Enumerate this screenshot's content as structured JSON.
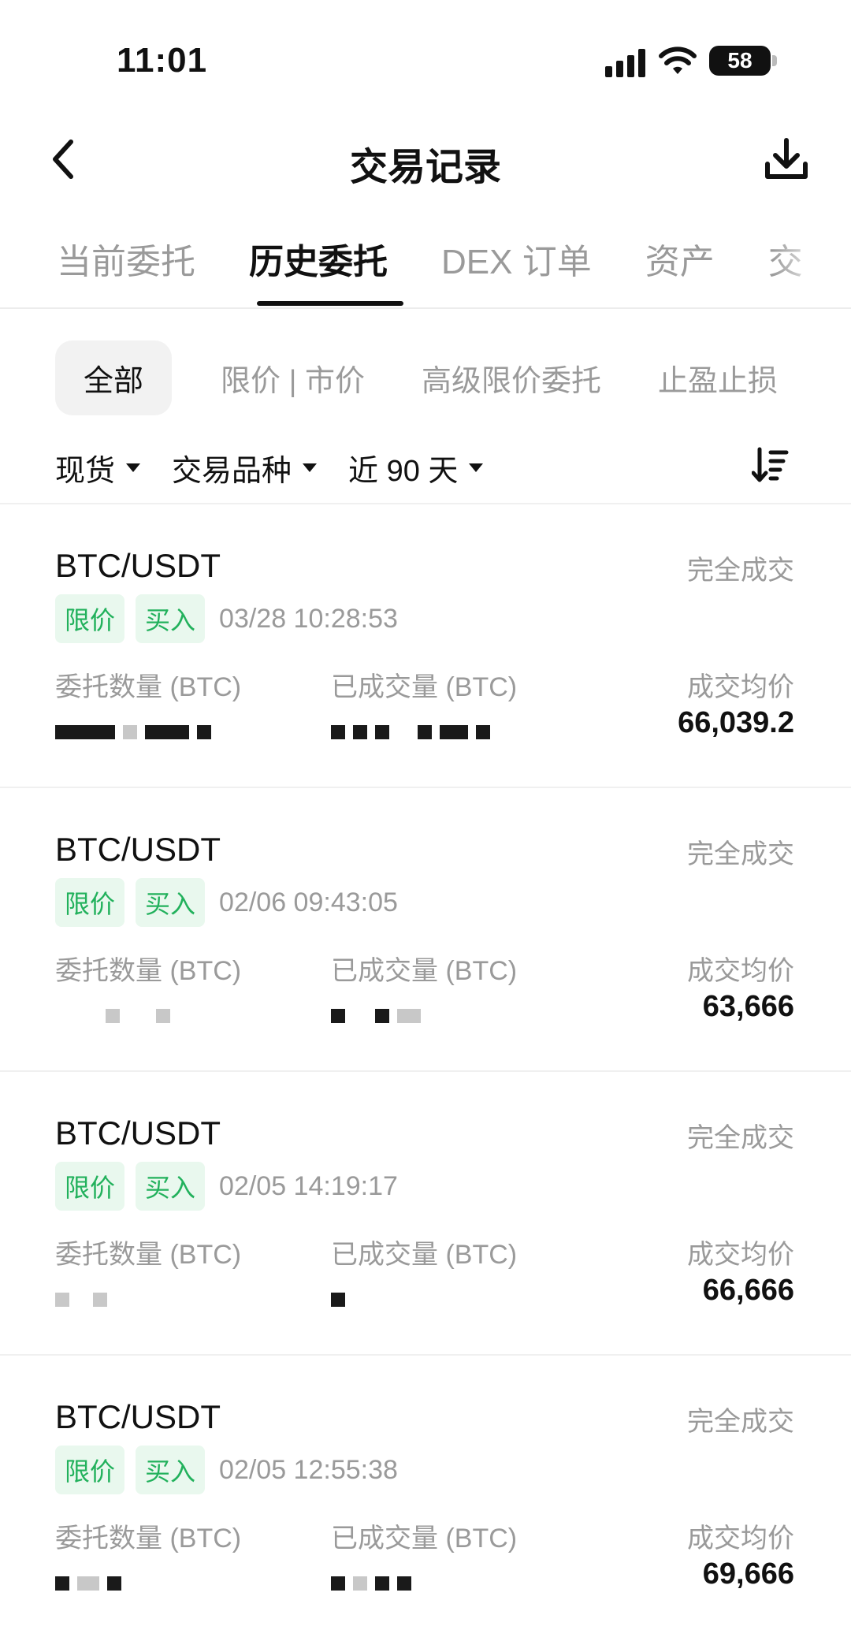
{
  "status_bar": {
    "time": "11:01",
    "battery": "58"
  },
  "header": {
    "title": "交易记录"
  },
  "tabs": [
    {
      "label": "当前委托",
      "active": false
    },
    {
      "label": "历史委托",
      "active": true
    },
    {
      "label": "DEX 订单",
      "active": false
    },
    {
      "label": "资产",
      "active": false
    },
    {
      "label": "交",
      "active": false
    }
  ],
  "pills": [
    {
      "label": "全部",
      "active": true
    },
    {
      "label": "限价 | 市价",
      "active": false
    },
    {
      "label": "高级限价委托",
      "active": false
    },
    {
      "label": "止盈止损",
      "active": false
    }
  ],
  "filters": {
    "market": "现货",
    "symbol": "交易品种",
    "period": "近 90 天"
  },
  "column_labels": {
    "order_qty": "委托数量 (BTC)",
    "filled_qty": "已成交量 (BTC)",
    "avg_price": "成交均价"
  },
  "orders": [
    {
      "pair": "BTC/USDT",
      "status": "完全成交",
      "type": "限价",
      "side": "买入",
      "time": "03/28 10:28:53",
      "avg_price": "66,039.2"
    },
    {
      "pair": "BTC/USDT",
      "status": "完全成交",
      "type": "限价",
      "side": "买入",
      "time": "02/06 09:43:05",
      "avg_price": "63,666"
    },
    {
      "pair": "BTC/USDT",
      "status": "完全成交",
      "type": "限价",
      "side": "买入",
      "time": "02/05 14:19:17",
      "avg_price": "66,666"
    },
    {
      "pair": "BTC/USDT",
      "status": "完全成交",
      "type": "限价",
      "side": "买入",
      "time": "02/05 12:55:38",
      "avg_price": "69,666"
    }
  ],
  "colors": {
    "tag_bg": "#e9f8ee",
    "tag_text": "#22b15c",
    "muted": "#9a9a9a"
  }
}
